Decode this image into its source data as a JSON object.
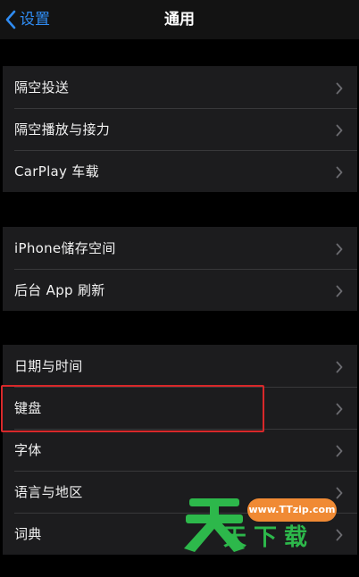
{
  "nav": {
    "back_label": "设置",
    "title": "通用"
  },
  "groups": [
    {
      "items": [
        {
          "label": "隔空投送"
        },
        {
          "label": "隔空播放与接力"
        },
        {
          "label": "CarPlay 车载"
        }
      ]
    },
    {
      "items": [
        {
          "label": "iPhone储存空间"
        },
        {
          "label": "后台 App 刷新"
        }
      ]
    },
    {
      "items": [
        {
          "label": "日期与时间"
        },
        {
          "label": "键盘"
        },
        {
          "label": "字体"
        },
        {
          "label": "语言与地区"
        },
        {
          "label": "词典"
        }
      ]
    }
  ],
  "watermark": {
    "url": "www.TTzip.com",
    "chars": [
      "天",
      "下",
      "载"
    ]
  },
  "colors": {
    "accent": "#2f8cf3",
    "highlight_border": "#d8282a",
    "watermark_green": "#2db84b",
    "watermark_orange": "#f08a34"
  }
}
